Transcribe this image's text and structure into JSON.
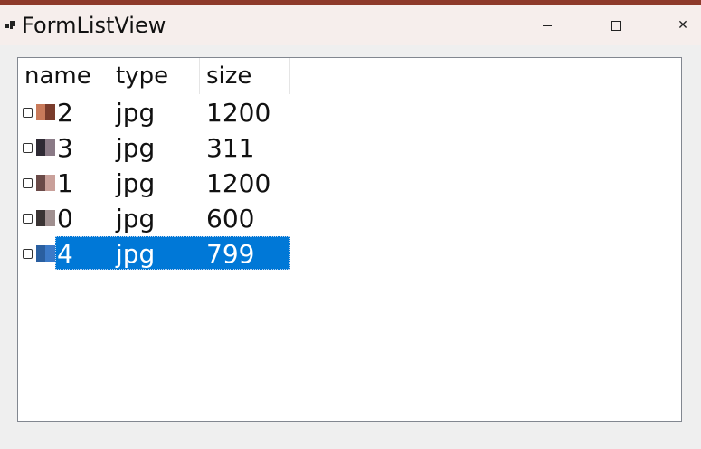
{
  "window": {
    "title": "FormListView",
    "minimize_symbol": "",
    "maximize_symbol": "",
    "close_symbol": "✕"
  },
  "listview": {
    "columns": [
      "name",
      "type",
      "size"
    ],
    "rows": [
      {
        "name": "2",
        "type": "jpg",
        "size": "1200",
        "selected": false,
        "thumb_colors": [
          "#c97a5a",
          "#7a3c2c"
        ]
      },
      {
        "name": "3",
        "type": "jpg",
        "size": "311",
        "selected": false,
        "thumb_colors": [
          "#2e2a34",
          "#8a7a86"
        ]
      },
      {
        "name": "1",
        "type": "jpg",
        "size": "1200",
        "selected": false,
        "thumb_colors": [
          "#6a4a48",
          "#c9a09a"
        ]
      },
      {
        "name": "0",
        "type": "jpg",
        "size": "600",
        "selected": false,
        "thumb_colors": [
          "#3a3434",
          "#a09090"
        ]
      },
      {
        "name": "4",
        "type": "jpg",
        "size": "799",
        "selected": true,
        "thumb_colors": [
          "#2a5fa0",
          "#3c7ac8"
        ]
      }
    ]
  },
  "colors": {
    "selection": "#0078d7",
    "titlebar": "#f6eeec",
    "background": "#efefef"
  }
}
